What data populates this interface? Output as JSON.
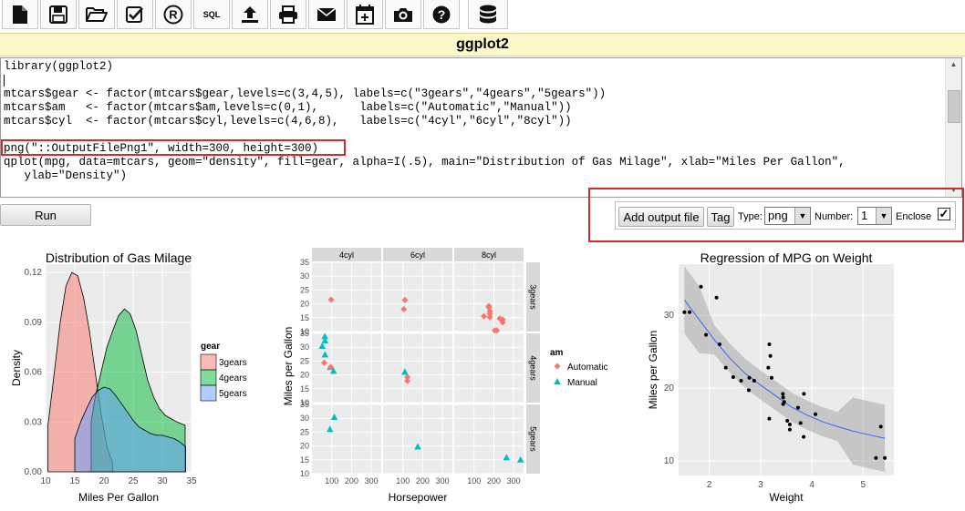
{
  "toolbar": {
    "buttons": [
      {
        "icon": "new-file-icon"
      },
      {
        "icon": "save-icon"
      },
      {
        "icon": "open-folder-icon"
      },
      {
        "icon": "checkmark-icon"
      },
      {
        "icon": "registered-icon",
        "glyph": "®"
      },
      {
        "icon": "sql-icon",
        "label": "SQL"
      },
      {
        "icon": "upload-icon"
      },
      {
        "icon": "print-icon"
      },
      {
        "icon": "envelope-icon"
      },
      {
        "icon": "calendar-add-icon"
      },
      {
        "icon": "camera-icon"
      },
      {
        "icon": "help-icon"
      },
      {
        "icon": "database-icon"
      }
    ]
  },
  "title": "ggplot2",
  "editor": {
    "code": "library(ggplot2)\n\nmtcars$gear <- factor(mtcars$gear,levels=c(3,4,5), labels=c(\"3gears\",\"4gears\",\"5gears\"))\nmtcars$am   <- factor(mtcars$am,levels=c(0,1),      labels=c(\"Automatic\",\"Manual\"))\nmtcars$cyl  <- factor(mtcars$cyl,levels=c(4,6,8),   labels=c(\"4cyl\",\"6cyl\",\"8cyl\"))\n\npng(\"::OutputFilePng1\", width=300, height=300)\nqplot(mpg, data=mtcars, geom=\"density\", fill=gear, alpha=I(.5), main=\"Distribution of Gas Milage\", xlab=\"Miles Per Gallon\",\n   ylab=\"Density\")"
  },
  "run_label": "Run",
  "output_panel": {
    "add_label": "Add output file",
    "tag_label": "Tag",
    "type_label": "Type:",
    "type_value": "png",
    "number_label": "Number:",
    "number_value": "1",
    "enclose_label": "Enclose",
    "enclose_checked": true
  },
  "colors": {
    "accent_red": "#d32b2b",
    "title_bg": "#fdf8c9",
    "pink": "#f8766d",
    "green": "#00ba38",
    "blue": "#619cff",
    "teal": "#00bfc4"
  },
  "chart_data": [
    {
      "type": "area",
      "title": "Distribution of Gas Milage",
      "xlabel": "Miles Per Gallon",
      "ylabel": "Density",
      "xlim": [
        10,
        35
      ],
      "ylim": [
        0,
        0.125
      ],
      "xticks": [
        "10",
        "15",
        "20",
        "25",
        "30",
        "35"
      ],
      "yticks": [
        "0.00",
        "0.03",
        "0.06",
        "0.09",
        "0.12"
      ],
      "legend_title": "gear",
      "legend_position": "right",
      "series": [
        {
          "name": "3gears",
          "color": "#f8766d",
          "x": [
            10.4,
            11.5,
            12.5,
            13.5,
            14.5,
            15.5,
            16.5,
            17.5,
            18.5,
            19.5,
            20.5,
            21.5
          ],
          "y": [
            0.028,
            0.06,
            0.09,
            0.112,
            0.12,
            0.118,
            0.105,
            0.085,
            0.06,
            0.035,
            0.015,
            0.005
          ]
        },
        {
          "name": "4gears",
          "color": "#00ba38",
          "x": [
            17.8,
            18.5,
            19.5,
            20.5,
            21.5,
            22.5,
            23.5,
            24.5,
            25.5,
            26.5,
            27.5,
            28.5,
            29.5,
            30.5,
            31.5,
            32.5,
            33.9
          ],
          "y": [
            0.03,
            0.045,
            0.06,
            0.075,
            0.085,
            0.094,
            0.098,
            0.095,
            0.085,
            0.07,
            0.055,
            0.045,
            0.038,
            0.034,
            0.032,
            0.03,
            0.028
          ]
        },
        {
          "name": "5gears",
          "color": "#619cff",
          "x": [
            15,
            16,
            17,
            18,
            19,
            20,
            21,
            22,
            23,
            24,
            25,
            26,
            27,
            28,
            29,
            30,
            31,
            32,
            33,
            34
          ],
          "y": [
            0.02,
            0.03,
            0.038,
            0.045,
            0.049,
            0.051,
            0.05,
            0.046,
            0.041,
            0.036,
            0.031,
            0.027,
            0.025,
            0.023,
            0.022,
            0.022,
            0.021,
            0.02,
            0.018,
            0.015
          ]
        }
      ]
    },
    {
      "type": "scatter",
      "xlabel": "Horsepower",
      "ylabel": "Miles per Gallon",
      "facet_cols": [
        "4cyl",
        "6cyl",
        "8cyl"
      ],
      "facet_rows": [
        "3gears",
        "4gears",
        "5gears"
      ],
      "xlim": [
        0,
        350
      ],
      "ylim": [
        10,
        35
      ],
      "xticks": [
        "100",
        "200",
        "300"
      ],
      "yticks": [
        "10",
        "15",
        "20",
        "25",
        "30",
        "35"
      ],
      "legend_title": "am",
      "legend_position": "right",
      "legend_entries": [
        {
          "name": "Automatic",
          "color": "#f8766d"
        },
        {
          "name": "Manual",
          "color": "#00bfc4"
        }
      ],
      "points": [
        {
          "col": 0,
          "row": 0,
          "am": "Automatic",
          "hp": 97,
          "mpg": 21.5
        },
        {
          "col": 1,
          "row": 0,
          "am": "Automatic",
          "hp": 110,
          "mpg": 21.4
        },
        {
          "col": 1,
          "row": 0,
          "am": "Automatic",
          "hp": 105,
          "mpg": 18.1
        },
        {
          "col": 2,
          "row": 0,
          "am": "Automatic",
          "hp": 175,
          "mpg": 18.7
        },
        {
          "col": 2,
          "row": 0,
          "am": "Automatic",
          "hp": 175,
          "mpg": 19.2
        },
        {
          "col": 2,
          "row": 0,
          "am": "Automatic",
          "hp": 180,
          "mpg": 17.3
        },
        {
          "col": 2,
          "row": 0,
          "am": "Automatic",
          "hp": 150,
          "mpg": 15.5
        },
        {
          "col": 2,
          "row": 0,
          "am": "Automatic",
          "hp": 180,
          "mpg": 16.4
        },
        {
          "col": 2,
          "row": 0,
          "am": "Automatic",
          "hp": 205,
          "mpg": 10.4
        },
        {
          "col": 2,
          "row": 0,
          "am": "Automatic",
          "hp": 215,
          "mpg": 10.4
        },
        {
          "col": 2,
          "row": 0,
          "am": "Automatic",
          "hp": 230,
          "mpg": 14.7
        },
        {
          "col": 2,
          "row": 0,
          "am": "Automatic",
          "hp": 245,
          "mpg": 14.3
        },
        {
          "col": 2,
          "row": 0,
          "am": "Automatic",
          "hp": 245,
          "mpg": 13.3
        },
        {
          "col": 2,
          "row": 0,
          "am": "Automatic",
          "hp": 180,
          "mpg": 15.2
        },
        {
          "col": 0,
          "row": 1,
          "am": "Manual",
          "hp": 66,
          "mpg": 32.4
        },
        {
          "col": 0,
          "row": 1,
          "am": "Manual",
          "hp": 52,
          "mpg": 30.4
        },
        {
          "col": 0,
          "row": 1,
          "am": "Manual",
          "hp": 65,
          "mpg": 33.9
        },
        {
          "col": 0,
          "row": 1,
          "am": "Manual",
          "hp": 66,
          "mpg": 27.3
        },
        {
          "col": 0,
          "row": 1,
          "am": "Manual",
          "hp": 93,
          "mpg": 22.8
        },
        {
          "col": 0,
          "row": 1,
          "am": "Manual",
          "hp": 109,
          "mpg": 21.4
        },
        {
          "col": 0,
          "row": 1,
          "am": "Automatic",
          "hp": 62,
          "mpg": 24.4
        },
        {
          "col": 0,
          "row": 1,
          "am": "Automatic",
          "hp": 95,
          "mpg": 22.8
        },
        {
          "col": 1,
          "row": 1,
          "am": "Manual",
          "hp": 110,
          "mpg": 21.0
        },
        {
          "col": 1,
          "row": 1,
          "am": "Manual",
          "hp": 110,
          "mpg": 21.0
        },
        {
          "col": 1,
          "row": 1,
          "am": "Automatic",
          "hp": 123,
          "mpg": 19.2
        },
        {
          "col": 1,
          "row": 1,
          "am": "Automatic",
          "hp": 123,
          "mpg": 17.8
        },
        {
          "col": 0,
          "row": 2,
          "am": "Manual",
          "hp": 91,
          "mpg": 26.0
        },
        {
          "col": 0,
          "row": 2,
          "am": "Manual",
          "hp": 113,
          "mpg": 30.4
        },
        {
          "col": 1,
          "row": 2,
          "am": "Manual",
          "hp": 175,
          "mpg": 19.7
        },
        {
          "col": 2,
          "row": 2,
          "am": "Manual",
          "hp": 264,
          "mpg": 15.8
        },
        {
          "col": 2,
          "row": 2,
          "am": "Manual",
          "hp": 335,
          "mpg": 15.0
        }
      ]
    },
    {
      "type": "scatter",
      "title": "Regression of MPG on Weight",
      "xlabel": "Weight",
      "ylabel": "Miles per Gallon",
      "xlim": [
        1.4,
        5.6
      ],
      "ylim": [
        8,
        37
      ],
      "xticks": [
        "2",
        "3",
        "4",
        "5"
      ],
      "yticks": [
        "10",
        "20",
        "30"
      ],
      "points": [
        [
          1.513,
          30.4
        ],
        [
          1.615,
          30.4
        ],
        [
          1.835,
          33.9
        ],
        [
          1.935,
          27.3
        ],
        [
          2.14,
          32.4
        ],
        [
          2.2,
          26.0
        ],
        [
          2.32,
          22.8
        ],
        [
          2.465,
          21.5
        ],
        [
          2.62,
          21.0
        ],
        [
          2.77,
          19.7
        ],
        [
          2.875,
          21.0
        ],
        [
          3.15,
          22.8
        ],
        [
          3.17,
          26.0
        ],
        [
          3.19,
          24.4
        ],
        [
          3.215,
          21.4
        ],
        [
          3.435,
          19.2
        ],
        [
          3.44,
          18.7
        ],
        [
          3.44,
          17.8
        ],
        [
          3.46,
          18.1
        ],
        [
          3.52,
          15.5
        ],
        [
          3.57,
          14.3
        ],
        [
          3.57,
          15.0
        ],
        [
          3.73,
          17.3
        ],
        [
          3.78,
          15.2
        ],
        [
          3.84,
          13.3
        ],
        [
          3.845,
          19.2
        ],
        [
          4.07,
          16.4
        ],
        [
          5.25,
          10.4
        ],
        [
          5.345,
          14.7
        ],
        [
          5.424,
          10.4
        ],
        [
          3.17,
          15.8
        ],
        [
          2.78,
          21.4
        ]
      ],
      "smooth": [
        [
          1.513,
          32.1
        ],
        [
          1.8,
          29.4
        ],
        [
          2.1,
          26.6
        ],
        [
          2.4,
          24.1
        ],
        [
          2.7,
          22.0
        ],
        [
          3.0,
          20.4
        ],
        [
          3.3,
          18.9
        ],
        [
          3.6,
          17.4
        ],
        [
          3.9,
          16.3
        ],
        [
          4.2,
          15.4
        ],
        [
          4.5,
          14.7
        ],
        [
          4.8,
          14.1
        ],
        [
          5.1,
          13.6
        ],
        [
          5.424,
          13.1
        ]
      ],
      "smooth_color": "#3366ff"
    }
  ]
}
